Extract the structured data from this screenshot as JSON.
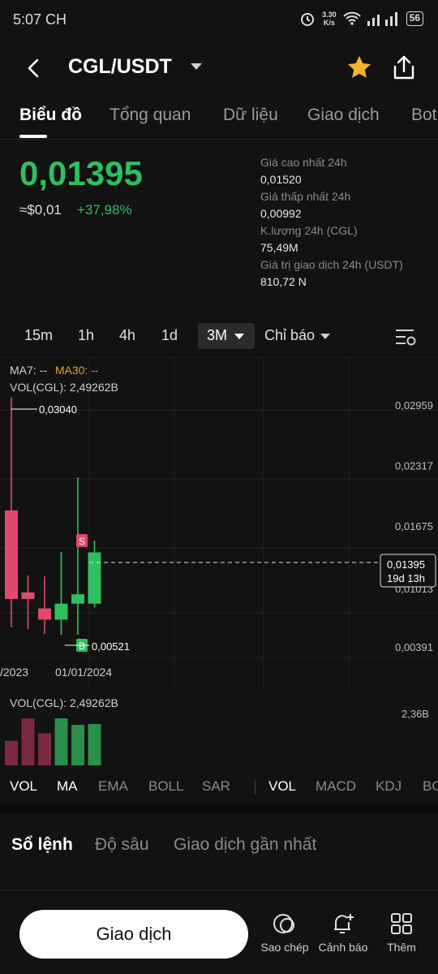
{
  "status": {
    "time": "5:07 CH",
    "net_speed": "3.30",
    "net_unit": "K/s",
    "battery": "56"
  },
  "header": {
    "pair": "CGL/USDT"
  },
  "tabs": [
    "Biểu đồ",
    "Tổng quan",
    "Dữ liệu",
    "Giao dịch",
    "Bot"
  ],
  "ticker": {
    "last_price": "0,01395",
    "usd_value": "≈$0,01",
    "change": "+37,98%"
  },
  "stats": {
    "high_label": "Giá cao nhất 24h",
    "high_value": "0,01520",
    "low_label": "Giá thấp nhất 24h",
    "low_value": "0,00992",
    "volume_label": "K.lượng 24h (CGL)",
    "volume_value": "75,49M",
    "turnover_label": "Giá trị giao dịch 24h (USDT)",
    "turnover_value": "810,72 N"
  },
  "intervals": {
    "items": [
      "15m",
      "1h",
      "4h",
      "1d"
    ],
    "selected": "3M",
    "indicators_label": "Chỉ báo"
  },
  "chart": {
    "ma7": "MA7: --",
    "ma30": "MA30: --",
    "vol": "VOL(CGL): 2,49262B",
    "max_label": "0,03040",
    "min_label": "0,00521",
    "current_price_tag": "0,01395",
    "countdown": "19d 13h",
    "sell_marker": "S",
    "buy_marker": "B",
    "date_left": "/2023",
    "date_right": "01/01/2024"
  },
  "volume_pane": {
    "label": "VOL(CGL): 2,49262B",
    "axis_max": "2,36B"
  },
  "indicators": {
    "main": [
      "VOL",
      "MA",
      "EMA",
      "BOLL",
      "SAR"
    ],
    "sub": [
      "VOL",
      "MACD",
      "KDJ",
      "BOLL"
    ]
  },
  "book_tabs": [
    "Sổ lệnh",
    "Độ sâu",
    "Giao dịch gần nhất"
  ],
  "bottom": {
    "trade": "Giao dịch",
    "copy": "Sao chép",
    "alert": "Cảnh báo",
    "more": "Thêm"
  },
  "colors": {
    "up": "#2fbf5f",
    "down": "#e0496b",
    "accent_star": "#f2b527",
    "ma30": "#e0a42a"
  },
  "chart_data": {
    "type": "candlestick",
    "y_ticks": [
      "0,02959",
      "0,02317",
      "0,01675",
      "0,01013",
      "0,00391"
    ],
    "ylim": [
      0.00391,
      0.02959
    ],
    "candles": [
      {
        "open": 0.0184,
        "close": 0.009,
        "high": 0.0304,
        "low": 0.006,
        "dir": "down"
      },
      {
        "open": 0.0097,
        "close": 0.009,
        "high": 0.0115,
        "low": 0.0058,
        "dir": "down"
      },
      {
        "open": 0.008,
        "close": 0.0068,
        "high": 0.0114,
        "low": 0.0053,
        "dir": "down"
      },
      {
        "open": 0.0068,
        "close": 0.0085,
        "high": 0.014,
        "low": 0.0052,
        "dir": "up"
      },
      {
        "open": 0.0085,
        "close": 0.0095,
        "high": 0.0219,
        "low": 0.0052,
        "dir": "up"
      },
      {
        "open": 0.0085,
        "close": 0.01395,
        "high": 0.0152,
        "low": 0.0081,
        "dir": "up"
      }
    ],
    "volumes": [
      {
        "value": 0.52,
        "dir": "down"
      },
      {
        "value": 1.0,
        "dir": "down"
      },
      {
        "value": 0.68,
        "dir": "down"
      },
      {
        "value": 1.0,
        "dir": "up"
      },
      {
        "value": 0.86,
        "dir": "up"
      },
      {
        "value": 0.88,
        "dir": "up"
      }
    ]
  }
}
